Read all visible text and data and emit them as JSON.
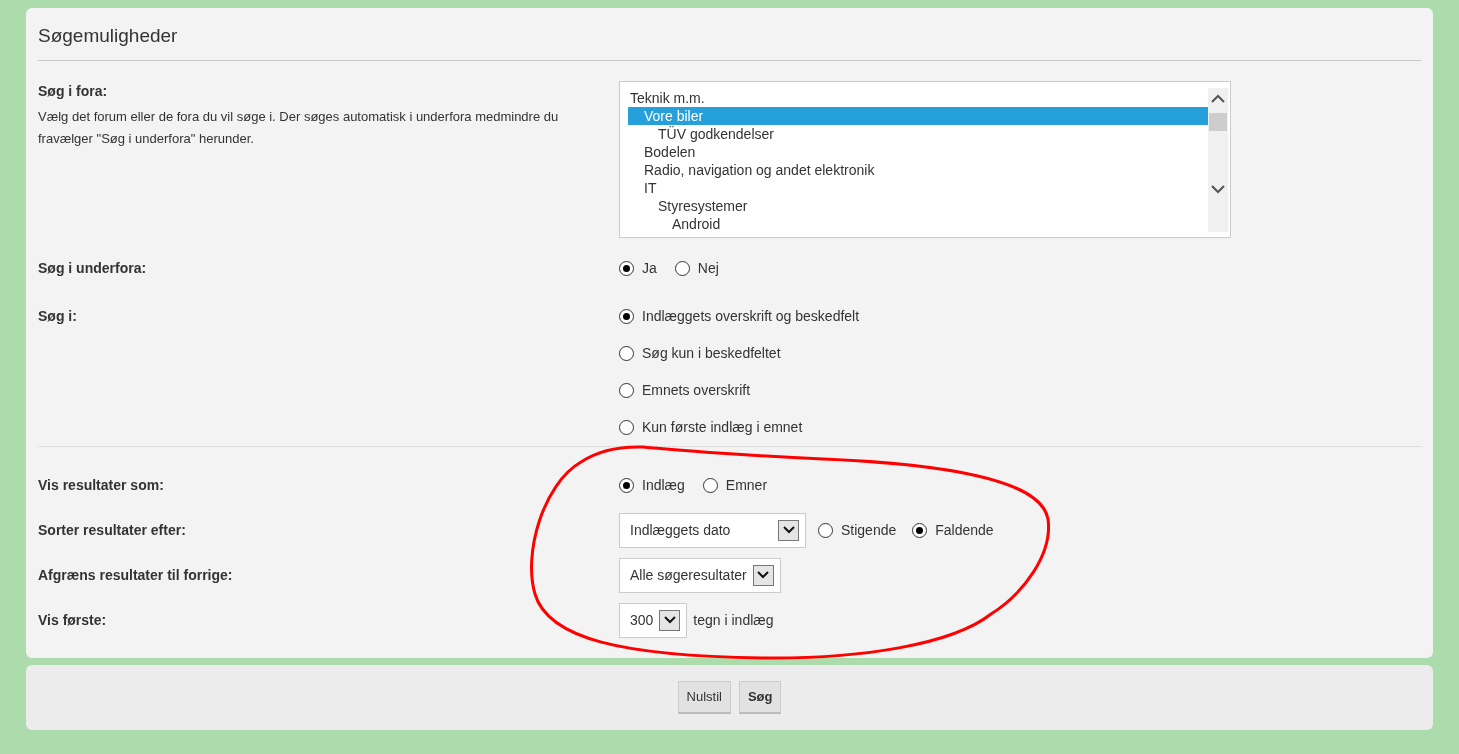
{
  "panel": {
    "title": "Søgemuligheder"
  },
  "search_fields": [
    {
      "kind": "listbox",
      "label": "Søg i fora:",
      "description": "Vælg det forum eller de fora du vil søge i. Der søges automatisk i underfora medmindre du fravælger \"Søg i underfora\" herunder.",
      "items": [
        {
          "label": "Teknik m.m.",
          "selected": false,
          "children": [
            {
              "label": "Vore biler",
              "selected": true,
              "children": [
                {
                  "label": "TÜV godkendelser",
                  "selected": false
                }
              ]
            },
            {
              "label": "Bodelen",
              "selected": false
            },
            {
              "label": "Radio, navigation og andet elektronik",
              "selected": false
            },
            {
              "label": "IT",
              "selected": false,
              "children": [
                {
                  "label": "Styresystemer",
                  "selected": false,
                  "children": [
                    {
                      "label": "Android",
                      "selected": false
                    }
                  ]
                }
              ]
            }
          ]
        }
      ]
    },
    {
      "kind": "radio_inline",
      "label": "Søg i underfora:",
      "options": [
        {
          "label": "Ja",
          "selected": true
        },
        {
          "label": "Nej",
          "selected": false
        }
      ]
    },
    {
      "kind": "radio_stack",
      "label": "Søg i:",
      "options": [
        {
          "label": "Indlæggets overskrift og beskedfelt",
          "selected": true
        },
        {
          "label": "Søg kun i beskedfeltet",
          "selected": false
        },
        {
          "label": "Emnets overskrift",
          "selected": false
        },
        {
          "label": "Kun første indlæg i emnet",
          "selected": false
        }
      ]
    }
  ],
  "result_fields": [
    {
      "kind": "radio_inline",
      "label": "Vis resultater som:",
      "options": [
        {
          "label": "Indlæg",
          "selected": true
        },
        {
          "label": "Emner",
          "selected": false
        }
      ]
    },
    {
      "kind": "select_radio",
      "label": "Sorter resultater efter:",
      "value": "Indlæggets dato",
      "options": [
        {
          "label": "Stigende",
          "selected": false
        },
        {
          "label": "Faldende",
          "selected": true
        }
      ]
    },
    {
      "kind": "select",
      "label": "Afgræns resultater til forrige:",
      "value": "Alle søgeresultater"
    },
    {
      "kind": "select_suffix",
      "label": "Vis første:",
      "value": "300",
      "suffix": "tegn i indlæg"
    }
  ],
  "buttons": [
    {
      "label": "Nulstil",
      "kind": "reset"
    },
    {
      "label": "Søg",
      "kind": "submit"
    }
  ]
}
